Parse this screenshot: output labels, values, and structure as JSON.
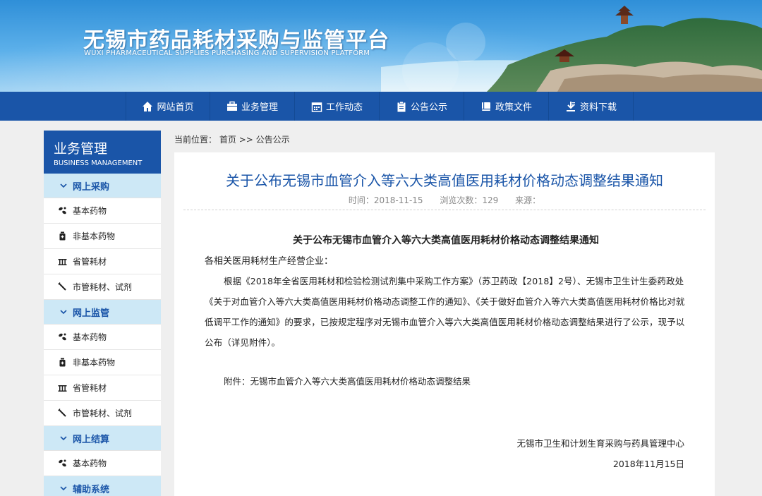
{
  "colors": {
    "brand_blue": "#1a55a8",
    "title_blue": "#1a55a8",
    "sidebar_category_bg": "#cde8f6",
    "page_bg": "#efefef"
  },
  "header": {
    "title": "无锡市药品耗材采购与监管平台",
    "subtitle": "WUXI PHARMACEUTICAL SUPPLIES PURCHASING AND SUPERVISION PLATFORM"
  },
  "nav": {
    "items": [
      {
        "label": "网站首页",
        "icon": "home-icon"
      },
      {
        "label": "业务管理",
        "icon": "briefcase-icon"
      },
      {
        "label": "工作动态",
        "icon": "calendar-icon"
      },
      {
        "label": "公告公示",
        "icon": "clipboard-icon"
      },
      {
        "label": "政策文件",
        "icon": "book-icon"
      },
      {
        "label": "资料下载",
        "icon": "download-icon"
      }
    ]
  },
  "sidebar": {
    "title": "业务管理",
    "subtitle": "BUSINESS MANAGEMENT",
    "sections": [
      {
        "label": "网上采购",
        "items": [
          {
            "label": "基本药物",
            "icon": "pills-icon"
          },
          {
            "label": "非基本药物",
            "icon": "bottle-icon"
          },
          {
            "label": "省管耗材",
            "icon": "grid-icon"
          },
          {
            "label": "市管耗材、试剂",
            "icon": "syringe-icon"
          }
        ]
      },
      {
        "label": "网上监管",
        "items": [
          {
            "label": "基本药物",
            "icon": "pills-icon"
          },
          {
            "label": "非基本药物",
            "icon": "bottle-icon"
          },
          {
            "label": "省管耗材",
            "icon": "grid-icon"
          },
          {
            "label": "市管耗材、试剂",
            "icon": "syringe-icon"
          }
        ]
      },
      {
        "label": "网上结算",
        "items": [
          {
            "label": "基本药物",
            "icon": "pills-icon"
          }
        ]
      },
      {
        "label": "辅助系统",
        "items": []
      }
    ]
  },
  "breadcrumb": {
    "prefix": "当前位置：",
    "home": "首页",
    "separator": ">>",
    "current": "公告公示"
  },
  "article": {
    "title": "关于公布无锡市血管介入等六大类高值医用耗材价格动态调整结果通知",
    "meta_time": "时间：2018-11-15",
    "meta_views": "浏览次数：129",
    "meta_source": "来源：",
    "body_title": "关于公布无锡市血管介入等六大类高值医用耗材价格动态调整结果通知",
    "salutation": "各相关医用耗材生产经营企业：",
    "paragraph": "根据《2018年全省医用耗材和检验检测试剂集中采购工作方案》（苏卫药政【2018】2号）、无锡市卫生计生委药政处《关于对血管介入等六大类高值医用耗材价格动态调整工作的通知》、《关于做好血管介入等六大类高值医用耗材价格比对就低调平工作的通知》的要求，已按规定程序对无锡市血管介入等六大类高值医用耗材价格动态调整结果进行了公示，现予以公布（详见附件）。",
    "attachment": "附件：无锡市血管介入等六大类高值医用耗材价格动态调整结果",
    "sign_org": "无锡市卫生和计划生育采购与药具管理中心",
    "sign_date": "2018年11月15日"
  }
}
